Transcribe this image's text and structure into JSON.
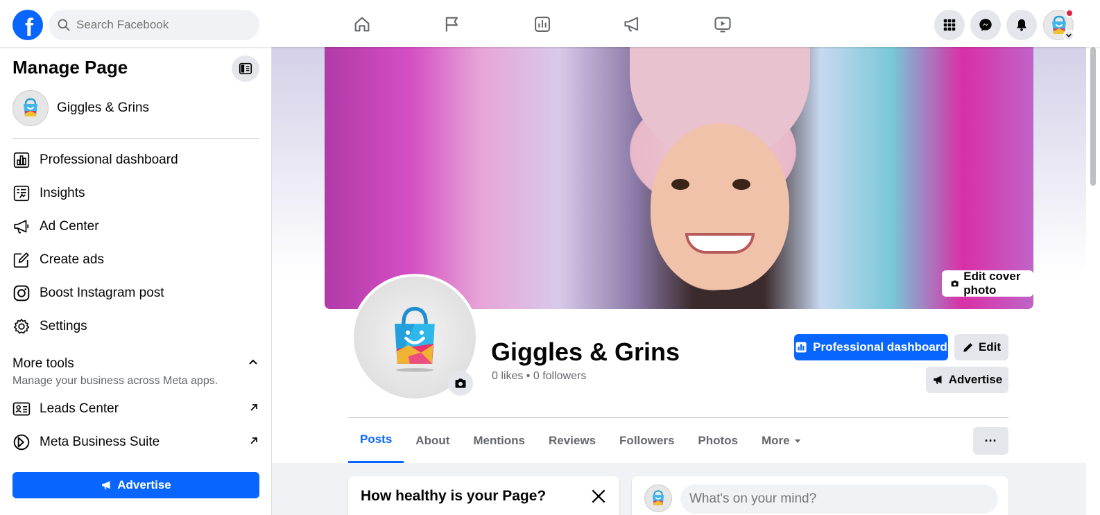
{
  "topbar": {
    "search_placeholder": "Search Facebook",
    "logo_letter": "f",
    "nav_icons": [
      "home-icon",
      "flag-icon",
      "chart-icon",
      "megaphone-icon",
      "video-icon"
    ],
    "right_icons": [
      "grid-menu-icon",
      "messenger-icon",
      "bell-icon"
    ]
  },
  "sidebar": {
    "title": "Manage Page",
    "page_name": "Giggles & Grins",
    "items": [
      {
        "label": "Professional dashboard",
        "icon": "dashboard-icon"
      },
      {
        "label": "Insights",
        "icon": "insights-icon"
      },
      {
        "label": "Ad Center",
        "icon": "megaphone-icon"
      },
      {
        "label": "Create ads",
        "icon": "pencil-square-icon"
      },
      {
        "label": "Boost Instagram post",
        "icon": "instagram-icon"
      },
      {
        "label": "Settings",
        "icon": "gear-icon"
      }
    ],
    "more_tools_title": "More tools",
    "more_tools_sub": "Manage your business across Meta apps.",
    "tools": [
      {
        "label": "Leads Center",
        "icon": "id-card-icon"
      },
      {
        "label": "Meta Business Suite",
        "icon": "meta-business-icon"
      }
    ],
    "advertise_label": "Advertise"
  },
  "profile": {
    "edit_cover_label": "Edit cover photo",
    "page_name": "Giggles & Grins",
    "stats": "0 likes • 0 followers",
    "pro_dashboard_label": "Professional dashboard",
    "edit_label": "Edit",
    "advertise_label": "Advertise",
    "more_button": "···"
  },
  "tabs": [
    {
      "label": "Posts",
      "active": true
    },
    {
      "label": "About",
      "active": false
    },
    {
      "label": "Mentions",
      "active": false
    },
    {
      "label": "Reviews",
      "active": false
    },
    {
      "label": "Followers",
      "active": false
    },
    {
      "label": "Photos",
      "active": false
    },
    {
      "label": "More",
      "active": false
    }
  ],
  "health_card": {
    "title": "How healthy is your Page?"
  },
  "composer": {
    "placeholder": "What's on your mind?"
  },
  "colors": {
    "brand": "#0866ff",
    "notification": "#e41e3f"
  }
}
